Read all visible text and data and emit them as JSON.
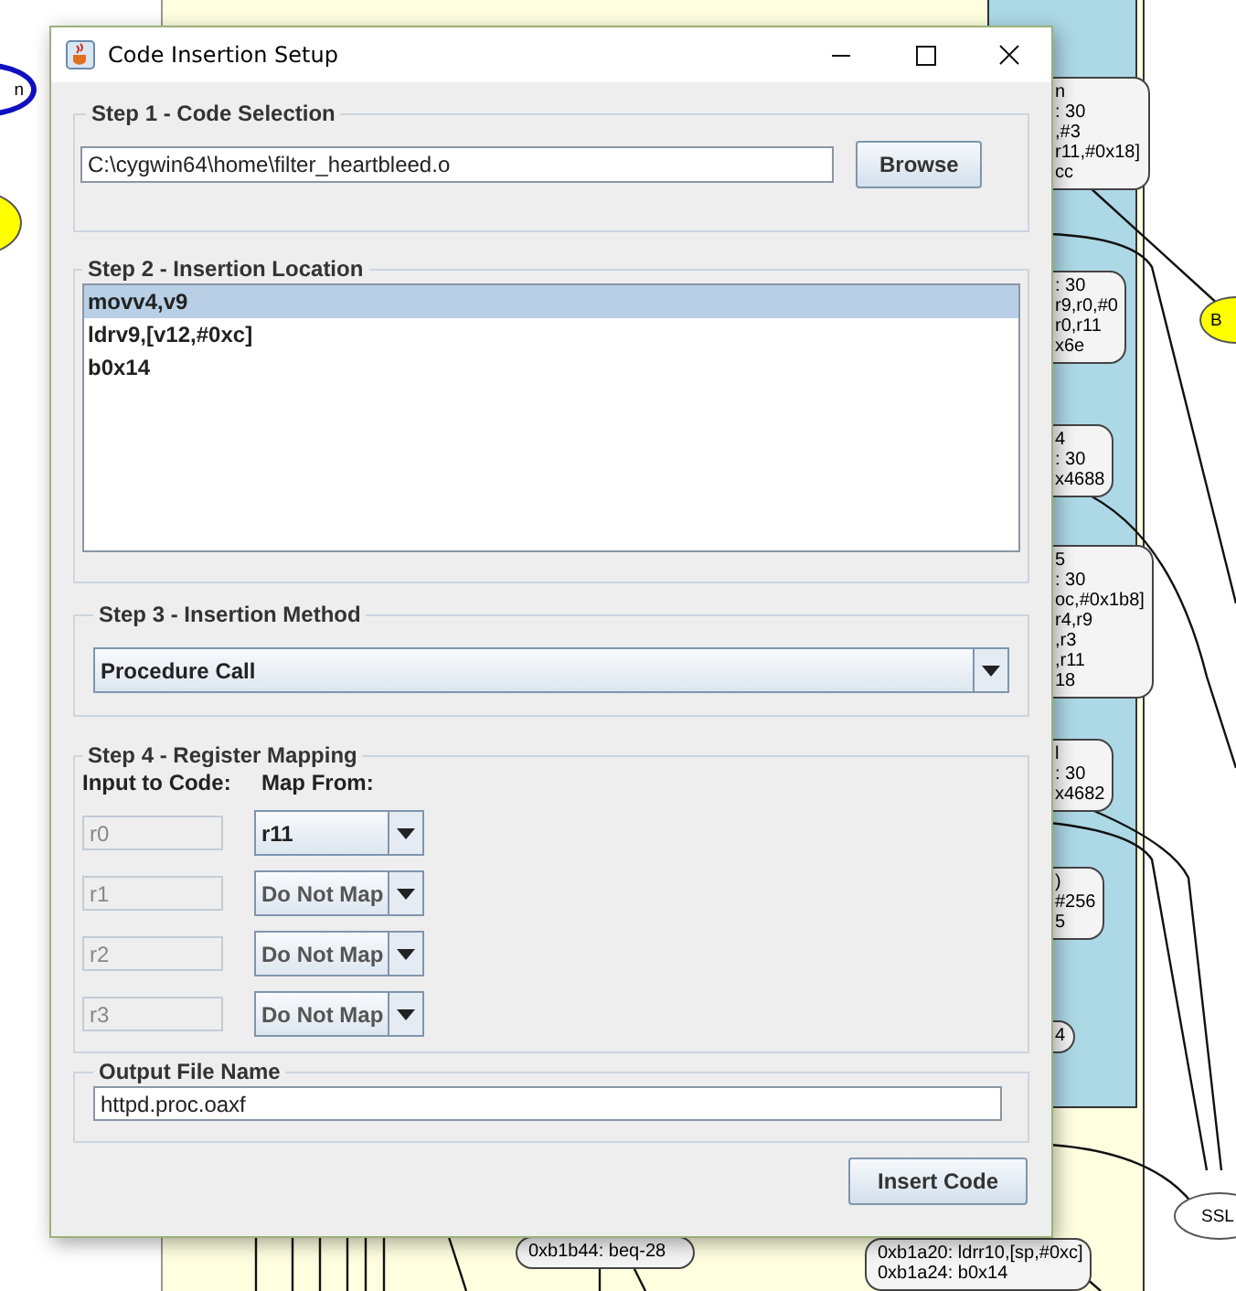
{
  "background_graph": {
    "nodes": [
      {
        "lines": [
          "n",
          ": 30",
          ",#3",
          "r11,#0x18]",
          "cc"
        ]
      },
      {
        "lines": [
          ": 30",
          "r9,r0,#0",
          "r0,r11",
          "x6e"
        ]
      },
      {
        "lines": [
          "4",
          ": 30",
          "x4688"
        ]
      },
      {
        "lines": [
          "5",
          ": 30",
          "oc,#0x1b8]",
          "r4,r9",
          ",r3",
          ",r11",
          "18"
        ]
      },
      {
        "lines": [
          "l",
          ": 30",
          "x4682"
        ]
      },
      {
        "lines": [
          ")",
          "#256",
          "5"
        ]
      },
      {
        "lines": [
          "4"
        ]
      },
      {
        "lines": [
          "0xb1b44: beq-28"
        ]
      },
      {
        "lines": [
          "0xb1a20: ldrr10,[sp,#0xc]",
          "0xb1a24: b0x14"
        ]
      }
    ],
    "ellipses": [
      {
        "label": "n",
        "color": "#ffffff"
      },
      {
        "color": "#ffff00"
      },
      {
        "label": "B",
        "color": "#ffff00"
      },
      {
        "label": "SSL",
        "color": "#ffffff"
      }
    ]
  },
  "window": {
    "title": "Code Insertion Setup"
  },
  "step1": {
    "legend": "Step 1 - Code Selection",
    "path": "C:\\cygwin64\\home\\filter_heartbleed.o",
    "browse": "Browse"
  },
  "step2": {
    "legend": "Step 2 - Insertion Location",
    "items": [
      {
        "label": "movv4,v9",
        "selected": true
      },
      {
        "label": "ldrv9,[v12,#0xc]",
        "selected": false
      },
      {
        "label": "b0x14",
        "selected": false
      }
    ]
  },
  "step3": {
    "legend": "Step 3 - Insertion Method",
    "method": "Procedure Call"
  },
  "step4": {
    "legend": "Step 4 - Register Mapping",
    "input_heading": "Input to Code:",
    "map_heading": "Map From:",
    "rows": [
      {
        "input": "r0",
        "map": "r11",
        "mapped": true
      },
      {
        "input": "r1",
        "map": "Do Not Map",
        "mapped": false
      },
      {
        "input": "r2",
        "map": "Do Not Map",
        "mapped": false
      },
      {
        "input": "r3",
        "map": "Do Not Map",
        "mapped": false
      }
    ]
  },
  "output": {
    "legend": "Output File Name",
    "value": "httpd.proc.oaxf"
  },
  "insert_button": "Insert Code"
}
